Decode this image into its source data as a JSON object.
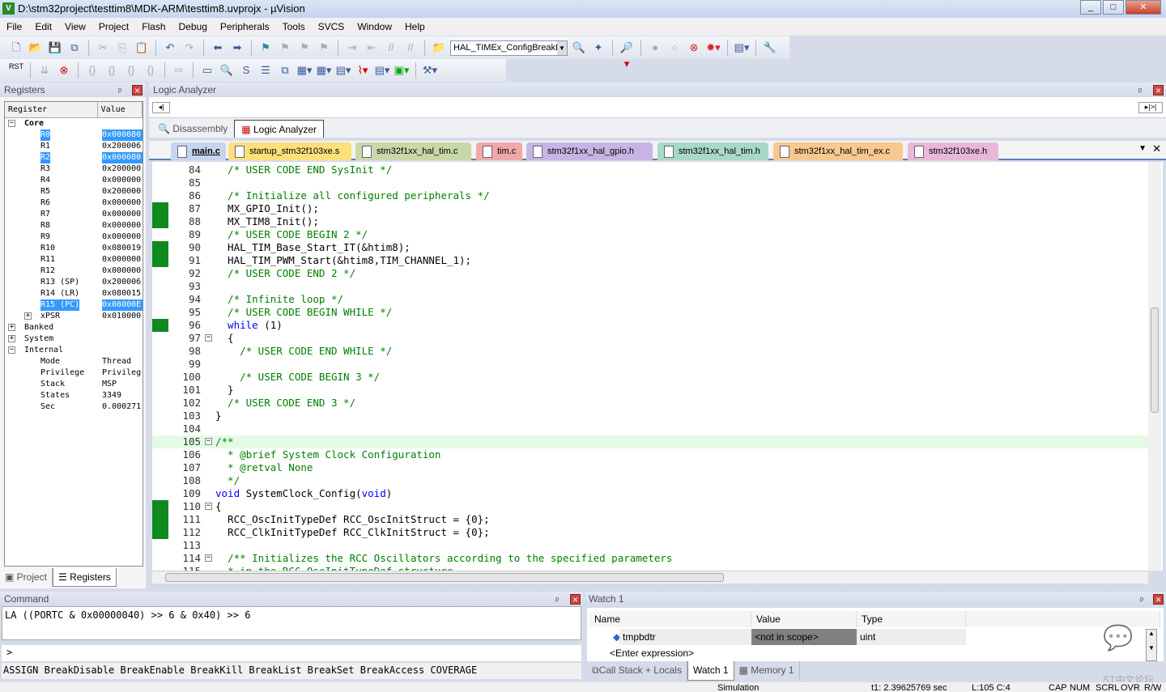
{
  "window": {
    "title": "D:\\stm32project\\testtim8\\MDK-ARM\\testtim8.uvprojx - µVision",
    "controls": [
      "minimize",
      "maximize",
      "close"
    ]
  },
  "menu": [
    "File",
    "Edit",
    "View",
    "Project",
    "Flash",
    "Debug",
    "Peripherals",
    "Tools",
    "SVCS",
    "Window",
    "Help"
  ],
  "toolbar": {
    "find_value": "HAL_TIMEx_ConfigBreakD",
    "reset_label": "RST"
  },
  "registers": {
    "title": "Registers",
    "col_register": "Register",
    "col_value": "Value",
    "core_label": "Core",
    "core": [
      {
        "name": "R0",
        "value": "0x000080",
        "sel": true
      },
      {
        "name": "R1",
        "value": "0x200006"
      },
      {
        "name": "R2",
        "value": "0x000080",
        "sel": true
      },
      {
        "name": "R3",
        "value": "0x200000"
      },
      {
        "name": "R4",
        "value": "0x000000"
      },
      {
        "name": "R5",
        "value": "0x200000"
      },
      {
        "name": "R6",
        "value": "0x000000"
      },
      {
        "name": "R7",
        "value": "0x000000"
      },
      {
        "name": "R8",
        "value": "0x000000"
      },
      {
        "name": "R9",
        "value": "0x000000"
      },
      {
        "name": "R10",
        "value": "0x080019"
      },
      {
        "name": "R11",
        "value": "0x000000"
      },
      {
        "name": "R12",
        "value": "0x000000"
      },
      {
        "name": "R13 (SP)",
        "value": "0x200006"
      },
      {
        "name": "R14 (LR)",
        "value": "0x080015"
      },
      {
        "name": "R15 (PC)",
        "value": "0x08000E",
        "sel": true
      },
      {
        "name": "xPSR",
        "value": "0x010000"
      }
    ],
    "groups": [
      "Banked",
      "System",
      "Internal"
    ],
    "internal": [
      {
        "name": "Mode",
        "value": "Thread"
      },
      {
        "name": "Privilege",
        "value": "Privileg"
      },
      {
        "name": "Stack",
        "value": "MSP"
      },
      {
        "name": "States",
        "value": "3349"
      },
      {
        "name": "Sec",
        "value": "0.000271"
      }
    ],
    "tabs": [
      "Project",
      "Registers"
    ]
  },
  "logic_analyzer": {
    "title": "Logic Analyzer"
  },
  "view_tabs": [
    "Disassembly",
    "Logic Analyzer"
  ],
  "file_tabs": [
    {
      "label": "main.c",
      "color": "#c6d4ee"
    },
    {
      "label": "startup_stm32f103xe.s",
      "color": "#fbe07c"
    },
    {
      "label": "stm32f1xx_hal_tim.c",
      "color": "#c8d8a8"
    },
    {
      "label": "tim.c",
      "color": "#f0a8a8"
    },
    {
      "label": "stm32f1xx_hal_gpio.h",
      "color": "#c8b4e4"
    },
    {
      "label": "stm32f1xx_hal_tim.h",
      "color": "#a8d8c8"
    },
    {
      "label": "stm32f1xx_hal_tim_ex.c",
      "color": "#f8c890"
    },
    {
      "label": "stm32f103xe.h",
      "color": "#e8b8d8"
    }
  ],
  "code": [
    {
      "n": "84",
      "seg": [
        [
          "  /* USER CODE END SysInit */",
          "c"
        ]
      ]
    },
    {
      "n": "85",
      "seg": []
    },
    {
      "n": "86",
      "seg": [
        [
          "  /* Initialize all configured peripherals */",
          "c"
        ]
      ]
    },
    {
      "n": "87",
      "mark": true,
      "seg": [
        [
          "  MX_GPIO_Init();",
          ""
        ]
      ]
    },
    {
      "n": "88",
      "mark": true,
      "seg": [
        [
          "  MX_TIM8_Init();",
          ""
        ]
      ]
    },
    {
      "n": "89",
      "seg": [
        [
          "  /* USER CODE BEGIN 2 */",
          "c"
        ]
      ]
    },
    {
      "n": "90",
      "mark": true,
      "seg": [
        [
          "  HAL_TIM_Base_Start_IT(&htim8);",
          ""
        ]
      ]
    },
    {
      "n": "91",
      "mark": true,
      "seg": [
        [
          "  HAL_TIM_PWM_Start(&htim8,TIM_CHANNEL_1);",
          ""
        ]
      ]
    },
    {
      "n": "92",
      "seg": [
        [
          "  /* USER CODE END 2 */",
          "c"
        ]
      ]
    },
    {
      "n": "93",
      "seg": []
    },
    {
      "n": "94",
      "seg": [
        [
          "  /* Infinite loop */",
          "c"
        ]
      ]
    },
    {
      "n": "95",
      "seg": [
        [
          "  /* USER CODE BEGIN WHILE */",
          "c"
        ]
      ]
    },
    {
      "n": "96",
      "mark": true,
      "seg": [
        [
          "  while",
          "k"
        ],
        [
          " (1)",
          ""
        ]
      ]
    },
    {
      "n": "97",
      "fold": "-",
      "seg": [
        [
          "  {",
          ""
        ]
      ]
    },
    {
      "n": "98",
      "seg": [
        [
          "    /* USER CODE END WHILE */",
          "c"
        ]
      ]
    },
    {
      "n": "99",
      "seg": []
    },
    {
      "n": "100",
      "seg": [
        [
          "    /* USER CODE BEGIN 3 */",
          "c"
        ]
      ]
    },
    {
      "n": "101",
      "seg": [
        [
          "  }",
          ""
        ]
      ]
    },
    {
      "n": "102",
      "seg": [
        [
          "  /* USER CODE END 3 */",
          "c"
        ]
      ]
    },
    {
      "n": "103",
      "seg": [
        [
          "}",
          ""
        ]
      ]
    },
    {
      "n": "104",
      "seg": []
    },
    {
      "n": "105",
      "fold": "-",
      "hl": true,
      "seg": [
        [
          "/**",
          "c"
        ]
      ]
    },
    {
      "n": "106",
      "seg": [
        [
          "  * @brief System Clock Configuration",
          "c"
        ]
      ]
    },
    {
      "n": "107",
      "seg": [
        [
          "  * @retval None",
          "c"
        ]
      ]
    },
    {
      "n": "108",
      "seg": [
        [
          "  */",
          "c"
        ]
      ]
    },
    {
      "n": "109",
      "seg": [
        [
          "void",
          "k"
        ],
        [
          " SystemClock_Config(",
          ""
        ],
        [
          "void",
          "k"
        ],
        [
          ")",
          ""
        ]
      ]
    },
    {
      "n": "110",
      "mark": true,
      "fold": "-",
      "seg": [
        [
          "{",
          ""
        ]
      ]
    },
    {
      "n": "111",
      "mark": true,
      "seg": [
        [
          "  RCC_OscInitTypeDef RCC_OscInitStruct = {0};",
          ""
        ]
      ]
    },
    {
      "n": "112",
      "mark": true,
      "seg": [
        [
          "  RCC_ClkInitTypeDef RCC_ClkInitStruct = {0};",
          ""
        ]
      ]
    },
    {
      "n": "113",
      "seg": []
    },
    {
      "n": "114",
      "fold": "-",
      "seg": [
        [
          "  /** Initializes the RCC Oscillators according to the specified parameters",
          "c"
        ]
      ]
    },
    {
      "n": "115",
      "seg": [
        [
          "  * in the RCC_OscInitTypeDef structure.",
          "c"
        ]
      ]
    }
  ],
  "command": {
    "title": "Command",
    "output": "LA ((PORTC & 0x00000040) >> 6 & 0x40) >> 6",
    "prompt": ">",
    "help": "ASSIGN BreakDisable BreakEnable BreakKill BreakList BreakSet BreakAccess COVERAGE"
  },
  "watch": {
    "title": "Watch 1",
    "cols": [
      "Name",
      "Value",
      "Type"
    ],
    "rows": [
      {
        "name": "tmpbdtr",
        "value": "<not in scope>",
        "type": "uint"
      }
    ],
    "enter": "<Enter expression>",
    "tabs": [
      "Call Stack + Locals",
      "Watch 1",
      "Memory 1"
    ]
  },
  "status": {
    "mode": "Simulation",
    "time": "t1: 2.39625769 sec",
    "pos": "L:105 C:4",
    "flags": [
      "CAP",
      "NUM",
      "SCRL",
      "OVR",
      "R/W"
    ]
  },
  "watermark": "ST中文论坛"
}
